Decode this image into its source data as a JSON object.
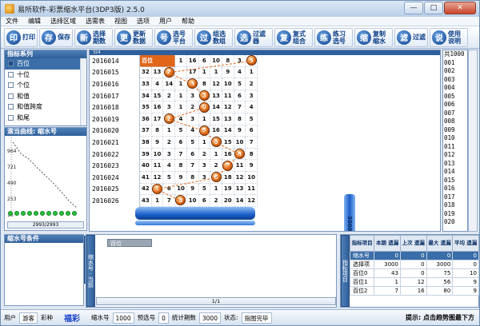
{
  "window": {
    "title": "易所软件-彩票缩水平台(3DP3版) 2.5.0",
    "minimize": "—",
    "maximize": "□",
    "close": "✕"
  },
  "menu": [
    "文件",
    "编辑",
    "选择区域",
    "选需表",
    "视图",
    "选项",
    "用户",
    "帮助"
  ],
  "toolbar": [
    {
      "icon": "印",
      "label": "打印"
    },
    {
      "icon": "存",
      "label": "保存"
    },
    {
      "icon": "新",
      "label": "选择 期数"
    },
    {
      "icon": "更",
      "label": "更新 数据"
    },
    {
      "icon": "号",
      "label": "选号 平台"
    },
    {
      "icon": "过",
      "label": "组选 数组"
    },
    {
      "icon": "选",
      "label": "过滤器"
    },
    {
      "icon": "复",
      "label": "复式 组合"
    },
    {
      "icon": "练",
      "label": "练习 选号"
    },
    {
      "icon": "缩",
      "label": "复制 缩水"
    },
    {
      "icon": "滤",
      "label": "过滤"
    },
    {
      "icon": "说",
      "label": "使用 说明"
    }
  ],
  "indicator_panel": {
    "title": "指标系列",
    "items": [
      "百位",
      "十位",
      "个位",
      "和值",
      "和值跨度",
      "和尾"
    ],
    "selected": 0
  },
  "curve_panel": {
    "title": "滚当曲线: 缩水号",
    "y_labels": [
      "964",
      "721",
      "490",
      "253",
      "16"
    ],
    "nav": "2993/2993",
    "points": [
      964,
      800,
      721,
      600,
      490,
      380,
      253,
      120,
      16
    ]
  },
  "grid": {
    "header": "324",
    "rows": [
      {
        "issue": "2016014",
        "cells": [
          "",
          "",
          "",
          "1",
          "16",
          "6",
          "10",
          "8",
          "3",
          "5"
        ],
        "ball": 9,
        "ball_value": "5",
        "hl": "百位"
      },
      {
        "issue": "2016015",
        "cells": [
          "32",
          "13",
          "3",
          "",
          "17",
          "1",
          "1",
          "9",
          "4",
          "1"
        ],
        "ball": 2,
        "ball_value": "2"
      },
      {
        "issue": "2016016",
        "cells": [
          "33",
          "4",
          "14",
          "1",
          "",
          "8",
          "12",
          "10",
          "5",
          "2"
        ],
        "ball": 4,
        "ball_value": "4"
      },
      {
        "issue": "2016017",
        "cells": [
          "34",
          "15",
          "2",
          "1",
          "3",
          "",
          "13",
          "11",
          "6",
          "3"
        ],
        "ball": 5,
        "ball_value": "5"
      },
      {
        "issue": "2016018",
        "cells": [
          "35",
          "16",
          "3",
          "1",
          "2",
          "",
          "14",
          "12",
          "7",
          "4"
        ],
        "ball": 5,
        "ball_value": "5"
      },
      {
        "issue": "2016019",
        "cells": [
          "36",
          "17",
          "",
          "4",
          "3",
          "1",
          "15",
          "13",
          "8",
          "5"
        ],
        "ball": 2,
        "ball_value": "2"
      },
      {
        "issue": "2016020",
        "cells": [
          "37",
          "8",
          "1",
          "5",
          "4",
          "",
          "16",
          "14",
          "9",
          "6"
        ],
        "ball": 5,
        "ball_value": "5"
      },
      {
        "issue": "2016021",
        "cells": [
          "38",
          "9",
          "2",
          "6",
          "5",
          "1",
          "",
          "15",
          "10",
          "7"
        ],
        "ball": 6,
        "ball_value": "6"
      },
      {
        "issue": "2016022",
        "cells": [
          "39",
          "10",
          "3",
          "7",
          "6",
          "2",
          "1",
          "16",
          "",
          "8"
        ],
        "ball": 8,
        "ball_value": "8"
      },
      {
        "issue": "2016023",
        "cells": [
          "40",
          "11",
          "4",
          "8",
          "7",
          "3",
          "2",
          "",
          "11",
          "9"
        ],
        "ball": 7,
        "ball_value": "7"
      },
      {
        "issue": "2016024",
        "cells": [
          "41",
          "12",
          "5",
          "9",
          "8",
          "3",
          "",
          "18",
          "12",
          "10"
        ],
        "ball": 6,
        "ball_value": "6"
      },
      {
        "issue": "2016025",
        "cells": [
          "42",
          "",
          "6",
          "10",
          "9",
          "5",
          "1",
          "19",
          "13",
          "11"
        ],
        "ball": 1,
        "ball_value": "1"
      },
      {
        "issue": "2016026",
        "cells": [
          "43",
          "1",
          "7",
          "",
          "10",
          "6",
          "2",
          "20",
          "14",
          "12"
        ],
        "ball": 3,
        "ball_value": "3"
      }
    ],
    "side_label": "3000 / 1000"
  },
  "col_numbers": [
    "共1000",
    "001",
    "002",
    "003",
    "004",
    "005",
    "006",
    "007",
    "008",
    "009",
    "010",
    "011",
    "012",
    "013",
    "014",
    "015",
    "016",
    "017",
    "018",
    "019",
    "020"
  ],
  "cond_panel": {
    "title": "缩水号条件",
    "tab": "备注"
  },
  "mid_panel": {
    "tab": "缩水号 :  当前",
    "header": "百位",
    "nav": "1/1"
  },
  "stats": {
    "tab": "指标项目",
    "columns": [
      "指标项目",
      "本期 遗漏",
      "上次 遗漏",
      "最大 遗漏",
      "平均 遗漏"
    ],
    "rows": [
      [
        "缩水号",
        "0",
        "0",
        "0",
        "0"
      ],
      [
        "选择项",
        "3000",
        "0",
        "3000",
        "0"
      ],
      [
        "百位0",
        "43",
        "0",
        "75",
        "10"
      ],
      [
        "百位1",
        "1",
        "12",
        "56",
        "9"
      ],
      [
        "百位2",
        "7",
        "16",
        "80",
        "9"
      ]
    ]
  },
  "status": {
    "user_label": "用户",
    "user": "游客",
    "lottery_label": "彩种",
    "brand": "福彩",
    "shrink_label": "缩水号",
    "shrink": "1000",
    "pre_label": "预选号",
    "pre": "0",
    "stat_label": "统计期数",
    "stat": "3000",
    "state_label": "状态:",
    "state": "指图完毕",
    "hint": "提示: 点击趋势图最下方"
  },
  "colors": {
    "accent": "#2f5f9a",
    "ball": "#e26f1b",
    "brand": "#1a46c8"
  }
}
